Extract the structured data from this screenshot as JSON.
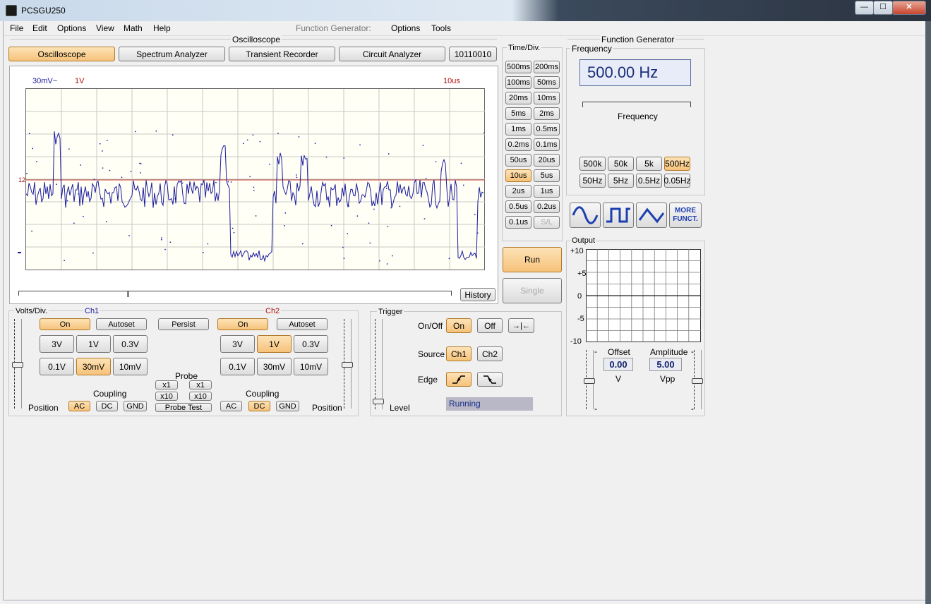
{
  "window": {
    "title": "PCSGU250",
    "min_label": "—",
    "max_label": "☐",
    "close_label": "✕"
  },
  "menu": {
    "left": [
      "File",
      "Edit",
      "Options",
      "View",
      "Math",
      "Help"
    ],
    "fg_label": "Function Generator:",
    "fg_items": [
      "Options",
      "Tools"
    ]
  },
  "scope_section": {
    "title": "Oscilloscope",
    "tabs": [
      "Oscilloscope",
      "Spectrum Analyzer",
      "Transient Recorder",
      "Circuit Analyzer",
      "10110010"
    ],
    "active_tab": 0,
    "ch1_scale": "30mV~",
    "ch2_scale": "1V",
    "time_scale": "10us",
    "trigger_marker": "12",
    "history_label": "History"
  },
  "timediv": {
    "title": "Time/Div.",
    "buttons": [
      [
        "500ms",
        "200ms"
      ],
      [
        "100ms",
        "50ms"
      ],
      [
        "20ms",
        "10ms"
      ],
      [
        "5ms",
        "2ms"
      ],
      [
        "1ms",
        "0.5ms"
      ],
      [
        "0.2ms",
        "0.1ms"
      ],
      [
        "50us",
        "20us"
      ],
      [
        "10us",
        "5us"
      ],
      [
        "2us",
        "1us"
      ],
      [
        "0.5us",
        "0.2us"
      ],
      [
        "0.1us",
        "S/L"
      ]
    ],
    "selected": "10us",
    "disabled": "S/L",
    "run_label": "Run",
    "single_label": "Single"
  },
  "volts": {
    "title": "Volts/Div.",
    "ch1": {
      "label": "Ch1",
      "on": "On",
      "autoset": "Autoset",
      "buttons": [
        "3V",
        "1V",
        "0.3V",
        "0.1V",
        "30mV",
        "10mV"
      ],
      "selected": "30mV",
      "coupling": [
        "AC",
        "DC",
        "GND"
      ],
      "coupling_selected": "AC"
    },
    "ch2": {
      "label": "Ch2",
      "on": "On",
      "autoset": "Autoset",
      "buttons": [
        "3V",
        "1V",
        "0.3V",
        "0.1V",
        "30mV",
        "10mV"
      ],
      "selected": "1V",
      "coupling": [
        "AC",
        "DC",
        "GND"
      ],
      "coupling_selected": "DC"
    },
    "persist": "Persist",
    "probe_label": "Probe",
    "probe_x1": "x1",
    "probe_x10": "x10",
    "probe_test": "Probe Test",
    "coupling_label": "Coupling",
    "position_label": "Position"
  },
  "trigger": {
    "title": "Trigger",
    "onoff_label": "On/Off",
    "on": "On",
    "off": "Off",
    "source_label": "Source",
    "sources": [
      "Ch1",
      "Ch2"
    ],
    "source_selected": "Ch1",
    "edge_label": "Edge",
    "level_label": "Level",
    "status": "Running"
  },
  "fg": {
    "title": "Function Generator",
    "freq_group": "Frequency",
    "frequency": "500.00 Hz",
    "slider_label": "Frequency",
    "ranges": [
      "500k",
      "50k",
      "5k",
      "500Hz",
      "50Hz",
      "5Hz",
      "0.5Hz",
      "0.05Hz"
    ],
    "range_selected": "500Hz",
    "more_label_1": "MORE",
    "more_label_2": "FUNCT.",
    "output_group": "Output",
    "y_ticks": [
      "+10",
      "+5",
      "0",
      "-5",
      "-10"
    ],
    "offset_label": "Offset",
    "offset_value": "0.00",
    "offset_unit": "V",
    "amplitude_label": "Amplitude",
    "amplitude_value": "5.00",
    "amplitude_unit": "Vpp",
    "slider_min": "-"
  },
  "colors": {
    "selected": "#f6c27b",
    "trace": "#1a1aa0",
    "trigger_line": "#c0392b",
    "ch2_label": "#b01010"
  }
}
